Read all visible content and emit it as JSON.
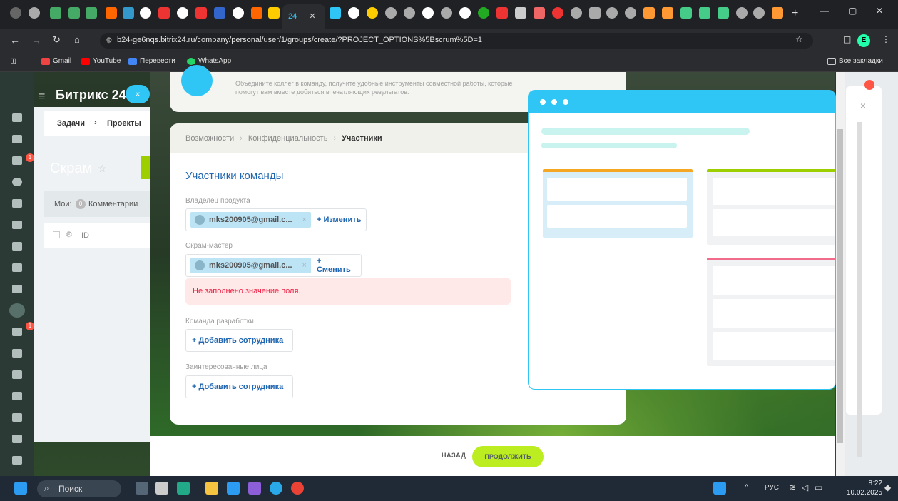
{
  "browser": {
    "tab_title": "24",
    "url": "b24-ge6nqs.bitrix24.ru/company/personal/user/1/groups/create/?PROJECT_OPTIONS%5Bscrum%5D=1",
    "bookmarks": [
      "Gmail",
      "YouTube",
      "Перевести",
      "WhatsApp"
    ],
    "all_bookmarks": "Все закладки",
    "profile_initial": "E"
  },
  "bitrix": {
    "logo": "Битрикс 24",
    "tabs": [
      "Задачи",
      "Проекты"
    ],
    "page_title": "Скрам",
    "filter_label": "Мои:",
    "filter_count": "0",
    "filter_comments": "Комментарии",
    "column_id": "ID",
    "badges": [
      "1",
      "1"
    ]
  },
  "top_card": {
    "text": "Объедините коллег в команду, получите удобные инструменты совместной работы, которые помогут вам вместе добиться впечатляющих результатов."
  },
  "breadcrumbs": [
    "Возможности",
    "Конфиденциальность",
    "Участники"
  ],
  "form": {
    "title": "Участники команды",
    "owner_label": "Владелец продукта",
    "owner_user": "mks200905@gmail.c...",
    "owner_change": "+ Изменить",
    "scrum_label": "Скрам-мастер",
    "scrum_user": "mks200905@gmail.c...",
    "scrum_change": "+ Сменить",
    "error": "Не заполнено значение поля.",
    "dev_label": "Команда разработки",
    "dev_add": "+ Добавить сотрудника",
    "stake_label": "Заинтересованные лица",
    "stake_add": "+ Добавить сотрудника"
  },
  "footer": {
    "back": "НАЗАД",
    "continue": "ПРОДОЛЖИТЬ"
  },
  "right_panel": {
    "close": "×"
  },
  "taskbar": {
    "search": "Поиск",
    "lang": "РУС",
    "time": "8:22",
    "date": "10.02.2025"
  },
  "colors": {
    "accent": "#2fc6f6",
    "continue": "#bbed21",
    "error_bg": "#ffe8e8",
    "error_text": "#e22244",
    "link": "#2066b0"
  }
}
